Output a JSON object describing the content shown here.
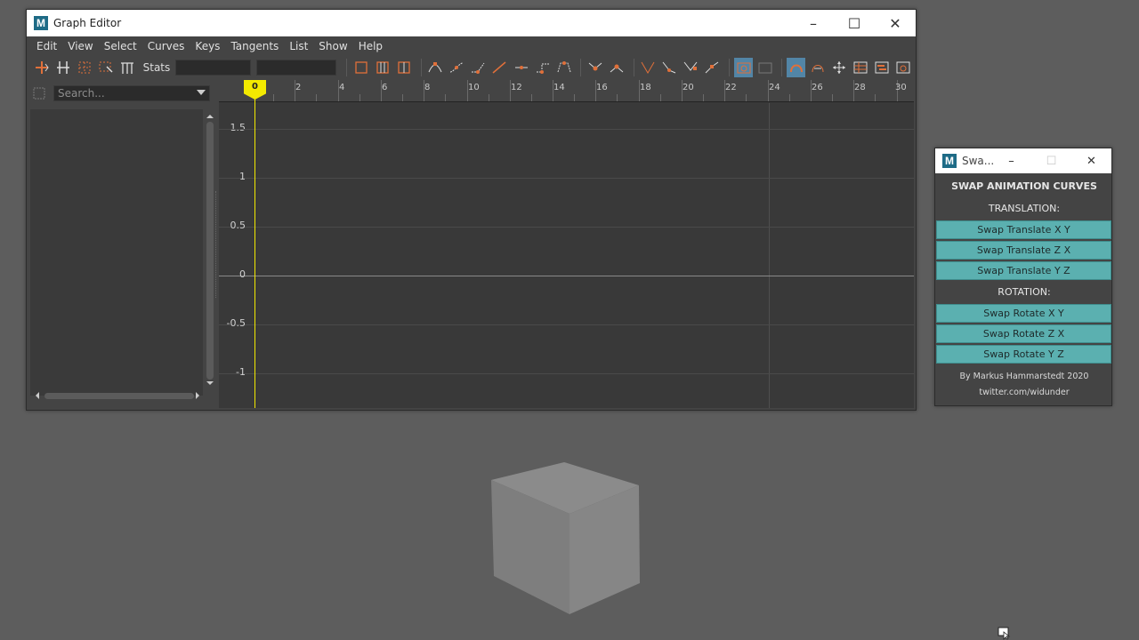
{
  "graph_editor": {
    "app_logo": "M",
    "title": "Graph Editor",
    "controls": {
      "minimize": "–",
      "maximize": "☐",
      "close": "✕"
    },
    "menus": [
      "Edit",
      "View",
      "Select",
      "Curves",
      "Keys",
      "Tangents",
      "List",
      "Show",
      "Help"
    ],
    "toolbar": {
      "stats_label": "Stats"
    },
    "outliner": {
      "search_placeholder": "Search..."
    },
    "ruler_ticks": [
      "0",
      "2",
      "4",
      "6",
      "8",
      "10",
      "12",
      "14",
      "16",
      "18",
      "20",
      "22",
      "24",
      "26",
      "28",
      "30"
    ],
    "current_frame": "0",
    "y_labels": [
      "1.5",
      "1",
      "0.5",
      "0",
      "-0.5",
      "-1"
    ]
  },
  "swap_panel": {
    "app_logo": "M",
    "title": "Swa...",
    "heading": "SWAP ANIMATION CURVES",
    "translation_label": "TRANSLATION:",
    "translation_buttons": [
      "Swap Translate X  Y",
      "Swap Translate Z  X",
      "Swap Translate Y  Z"
    ],
    "rotation_label": "ROTATION:",
    "rotation_buttons": [
      "Swap Rotate X  Y",
      "Swap Rotate Z  X",
      "Swap Rotate Y  Z"
    ],
    "credit": "By Markus Hammarstedt 2020",
    "twitter": "twitter.com/widunder"
  },
  "colors": {
    "accent_teal": "#5bb0b0",
    "playhead": "#f3ea00",
    "toolbar_orange": "#e0703a",
    "active_blue": "#5285a6"
  }
}
